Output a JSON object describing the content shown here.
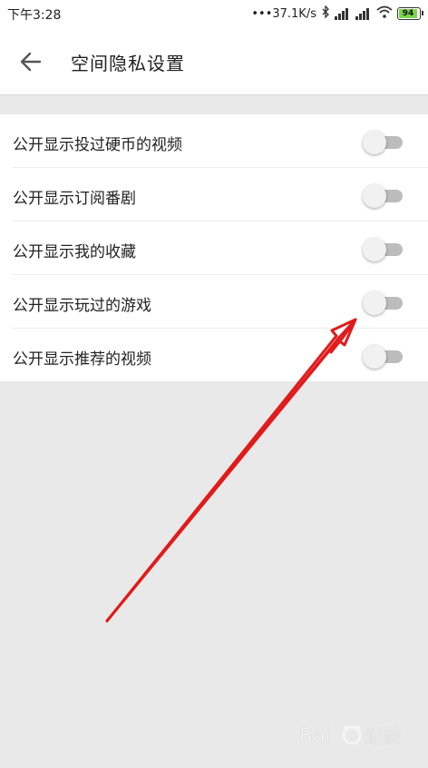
{
  "status_bar": {
    "time": "下午3:28",
    "network_speed": "•••37.1K/s",
    "battery": "94"
  },
  "header": {
    "title": "空间隐私设置",
    "back_icon": "arrow-left-icon"
  },
  "settings": [
    {
      "label": "公开显示投过硬币的视频",
      "enabled": false
    },
    {
      "label": "公开显示订阅番剧",
      "enabled": false
    },
    {
      "label": "公开显示我的收藏",
      "enabled": false
    },
    {
      "label": "公开显示玩过的游戏",
      "enabled": false
    },
    {
      "label": "公开显示推荐的视频",
      "enabled": false
    }
  ],
  "watermark": {
    "text": "Bai 经验"
  },
  "colors": {
    "annotation_arrow": "#e11b1b",
    "toggle_track_off": "#bcbcbc",
    "background": "#e9e9e9"
  }
}
